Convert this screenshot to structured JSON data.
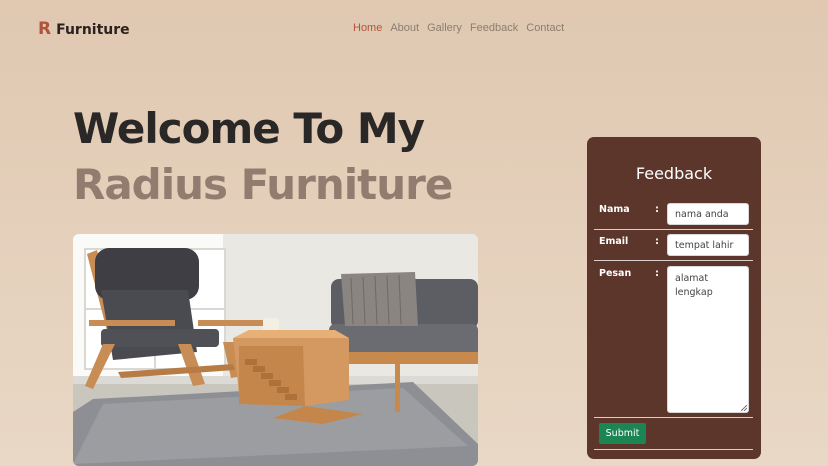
{
  "brand": {
    "letter": "R",
    "name": "Furniture"
  },
  "nav": [
    {
      "label": "Home",
      "active": true
    },
    {
      "label": "About",
      "active": false
    },
    {
      "label": "Gallery",
      "active": false
    },
    {
      "label": "Feedback",
      "active": false
    },
    {
      "label": "Contact",
      "active": false
    }
  ],
  "hero": {
    "line1": "Welcome To My",
    "line2": "Radius Furniture"
  },
  "form": {
    "title": "Feedback",
    "colon": ":",
    "fields": {
      "nama": {
        "label": "Nama",
        "placeholder": "nama anda"
      },
      "email": {
        "label": "Email",
        "placeholder": "tempat lahir"
      },
      "pesan": {
        "label": "Pesan",
        "placeholder": "alamat lengkap"
      }
    },
    "submit_label": "Submit"
  },
  "colors": {
    "accent": "#b1533a",
    "card": "#5c362b",
    "submit": "#1c8554",
    "hero_dark": "#2a2727",
    "hero_muted": "#927c70"
  }
}
